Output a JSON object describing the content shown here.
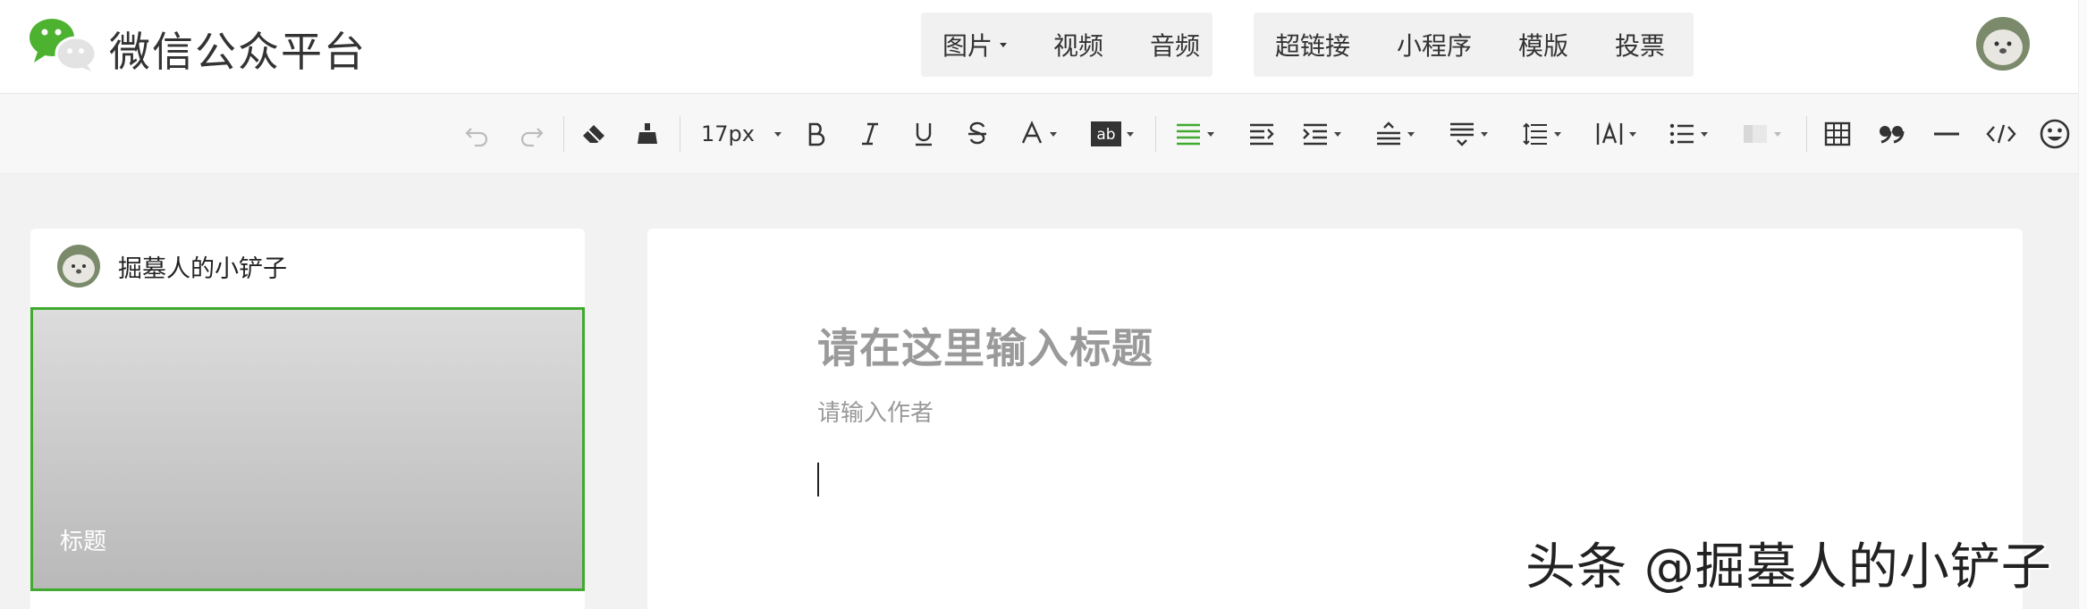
{
  "header": {
    "brand": "微信公众平台",
    "media_buttons": [
      "图片",
      "视频",
      "音频"
    ],
    "insert_buttons": [
      "超链接",
      "小程序",
      "模版",
      "投票"
    ]
  },
  "toolbar": {
    "font_size": "17px",
    "tools": [
      "undo-icon",
      "redo-icon",
      "eraser-icon",
      "format-brush-icon",
      "bold-icon",
      "italic-icon",
      "underline-icon",
      "strikethrough-icon",
      "font-color-icon",
      "background-color-icon",
      "align-icon",
      "indent-icon",
      "paragraph-indent-icon",
      "spacing-before-icon",
      "spacing-after-icon",
      "line-height-icon",
      "letter-spacing-icon",
      "list-icon",
      "image-border-icon",
      "table-icon",
      "quote-icon",
      "divider-icon",
      "code-icon",
      "emoji-icon"
    ],
    "accent_color": "#3faa2e"
  },
  "sidebar": {
    "account_name": "掘墓人的小铲子",
    "cover_title": "标题"
  },
  "editor": {
    "title_placeholder": "请在这里输入标题",
    "author_placeholder": "请输入作者"
  },
  "watermark": "头条 @掘墓人的小铲子"
}
